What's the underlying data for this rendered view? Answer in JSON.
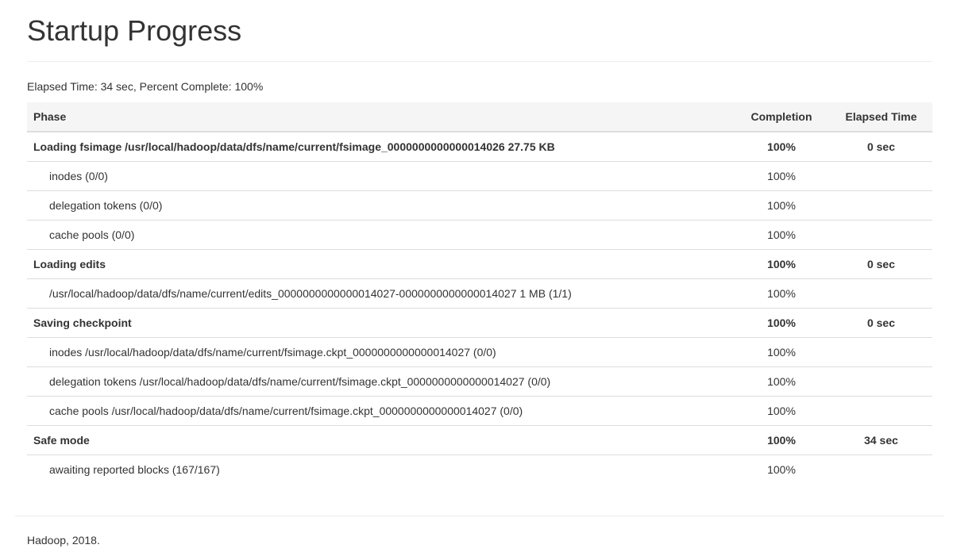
{
  "page": {
    "title": "Startup Progress",
    "summary": "Elapsed Time: 34 sec, Percent Complete: 100%"
  },
  "table": {
    "headers": {
      "phase": "Phase",
      "completion": "Completion",
      "elapsed": "Elapsed Time"
    },
    "rows": [
      {
        "type": "phase",
        "name": "Loading fsimage /usr/local/hadoop/data/dfs/name/current/fsimage_0000000000000014026 27.75 KB",
        "completion": "100%",
        "elapsed": "0 sec"
      },
      {
        "type": "step",
        "name": "inodes (0/0)",
        "completion": "100%",
        "elapsed": ""
      },
      {
        "type": "step",
        "name": "delegation tokens (0/0)",
        "completion": "100%",
        "elapsed": ""
      },
      {
        "type": "step",
        "name": "cache pools (0/0)",
        "completion": "100%",
        "elapsed": ""
      },
      {
        "type": "phase",
        "name": "Loading edits",
        "completion": "100%",
        "elapsed": "0 sec"
      },
      {
        "type": "step",
        "name": "/usr/local/hadoop/data/dfs/name/current/edits_0000000000000014027-0000000000000014027 1 MB (1/1)",
        "completion": "100%",
        "elapsed": ""
      },
      {
        "type": "phase",
        "name": "Saving checkpoint",
        "completion": "100%",
        "elapsed": "0 sec"
      },
      {
        "type": "step",
        "name": "inodes /usr/local/hadoop/data/dfs/name/current/fsimage.ckpt_0000000000000014027 (0/0)",
        "completion": "100%",
        "elapsed": ""
      },
      {
        "type": "step",
        "name": "delegation tokens /usr/local/hadoop/data/dfs/name/current/fsimage.ckpt_0000000000000014027 (0/0)",
        "completion": "100%",
        "elapsed": ""
      },
      {
        "type": "step",
        "name": "cache pools /usr/local/hadoop/data/dfs/name/current/fsimage.ckpt_0000000000000014027 (0/0)",
        "completion": "100%",
        "elapsed": ""
      },
      {
        "type": "phase",
        "name": "Safe mode",
        "completion": "100%",
        "elapsed": "34 sec"
      },
      {
        "type": "step",
        "name": "awaiting reported blocks (167/167)",
        "completion": "100%",
        "elapsed": ""
      }
    ]
  },
  "footer": {
    "text": "Hadoop, 2018."
  },
  "colors": {
    "text": "#333333",
    "header_bg": "#f5f5f5",
    "border": "#dddddd",
    "rule": "#eeeeee"
  }
}
